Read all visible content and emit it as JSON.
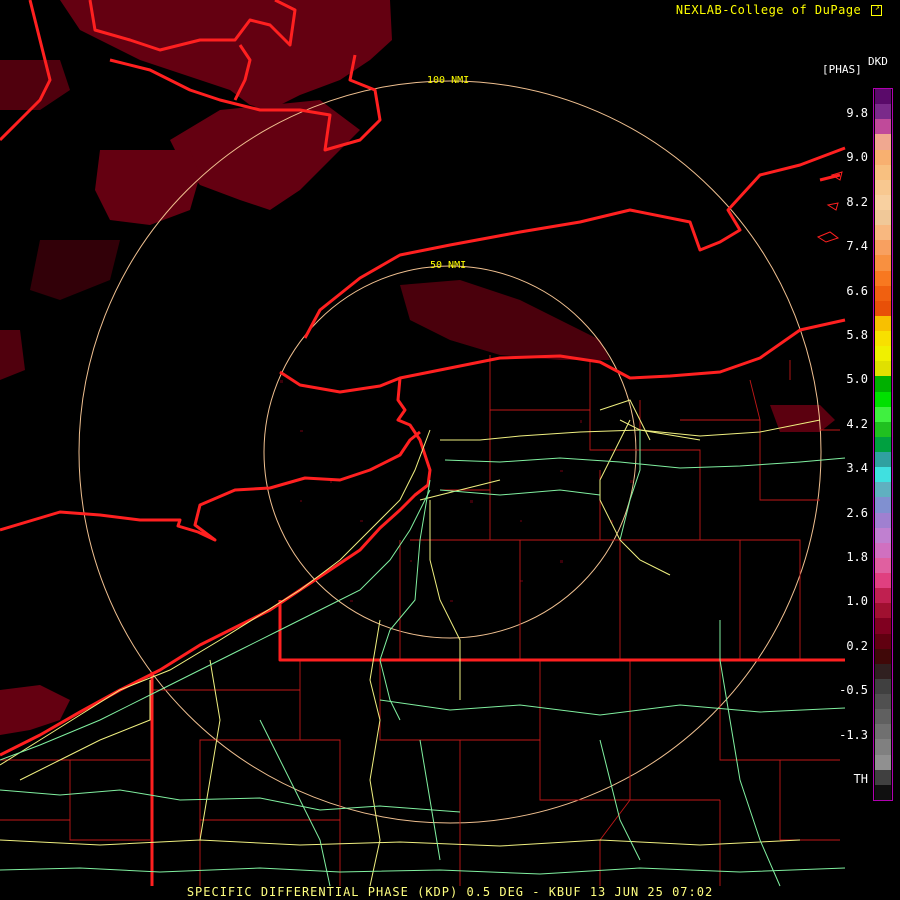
{
  "credit": "NEXLAB-College of DuPage",
  "credit_icon": "external-link-icon",
  "footer": "SPECIFIC DIFFERENTIAL PHASE (KDP) 0.5 DEG - KBUF 13 JUN 25 07:02",
  "range_rings": {
    "inner": "50 NMI",
    "outer": "100 NMI"
  },
  "colorbar": {
    "unit_top": "DKD",
    "unit_sub": "[PHAS]",
    "tick_labels": [
      "9.8",
      "9.0",
      "8.2",
      "7.4",
      "6.6",
      "5.8",
      "5.0",
      "4.2",
      "3.4",
      "2.6",
      "1.8",
      "1.0",
      "0.2",
      "-0.5",
      "-1.3",
      "TH"
    ],
    "colors": [
      "#5a0a6a",
      "#7a2a8a",
      "#c04a9a",
      "#f0a890",
      "#f8b070",
      "#f8c080",
      "#f8c890",
      "#f8d0a0",
      "#f0c898",
      "#f8b880",
      "#f8a060",
      "#f89040",
      "#f87820",
      "#f06010",
      "#e85008",
      "#f8c000",
      "#f8e000",
      "#f0f000",
      "#e0e000",
      "#00b000",
      "#00e000",
      "#40f040",
      "#20c020",
      "#00a040",
      "#30a0a0",
      "#40e0e0",
      "#60b0c0",
      "#8090d0",
      "#a080d0",
      "#c080d0",
      "#d070c0",
      "#e060a0",
      "#e04080",
      "#c02050",
      "#a01030",
      "#800020",
      "#600010",
      "#400808",
      "#302020",
      "#404040",
      "#505050",
      "#606060",
      "#707070",
      "#808080",
      "#909090",
      "#404040",
      "#101010"
    ]
  },
  "colors": {
    "state_border": "#ff2020",
    "county_border": "#c01818",
    "highway": "#f0f080",
    "interstate": "#80f0a0",
    "ring": "#f0c090",
    "echo": "#6a0012"
  }
}
